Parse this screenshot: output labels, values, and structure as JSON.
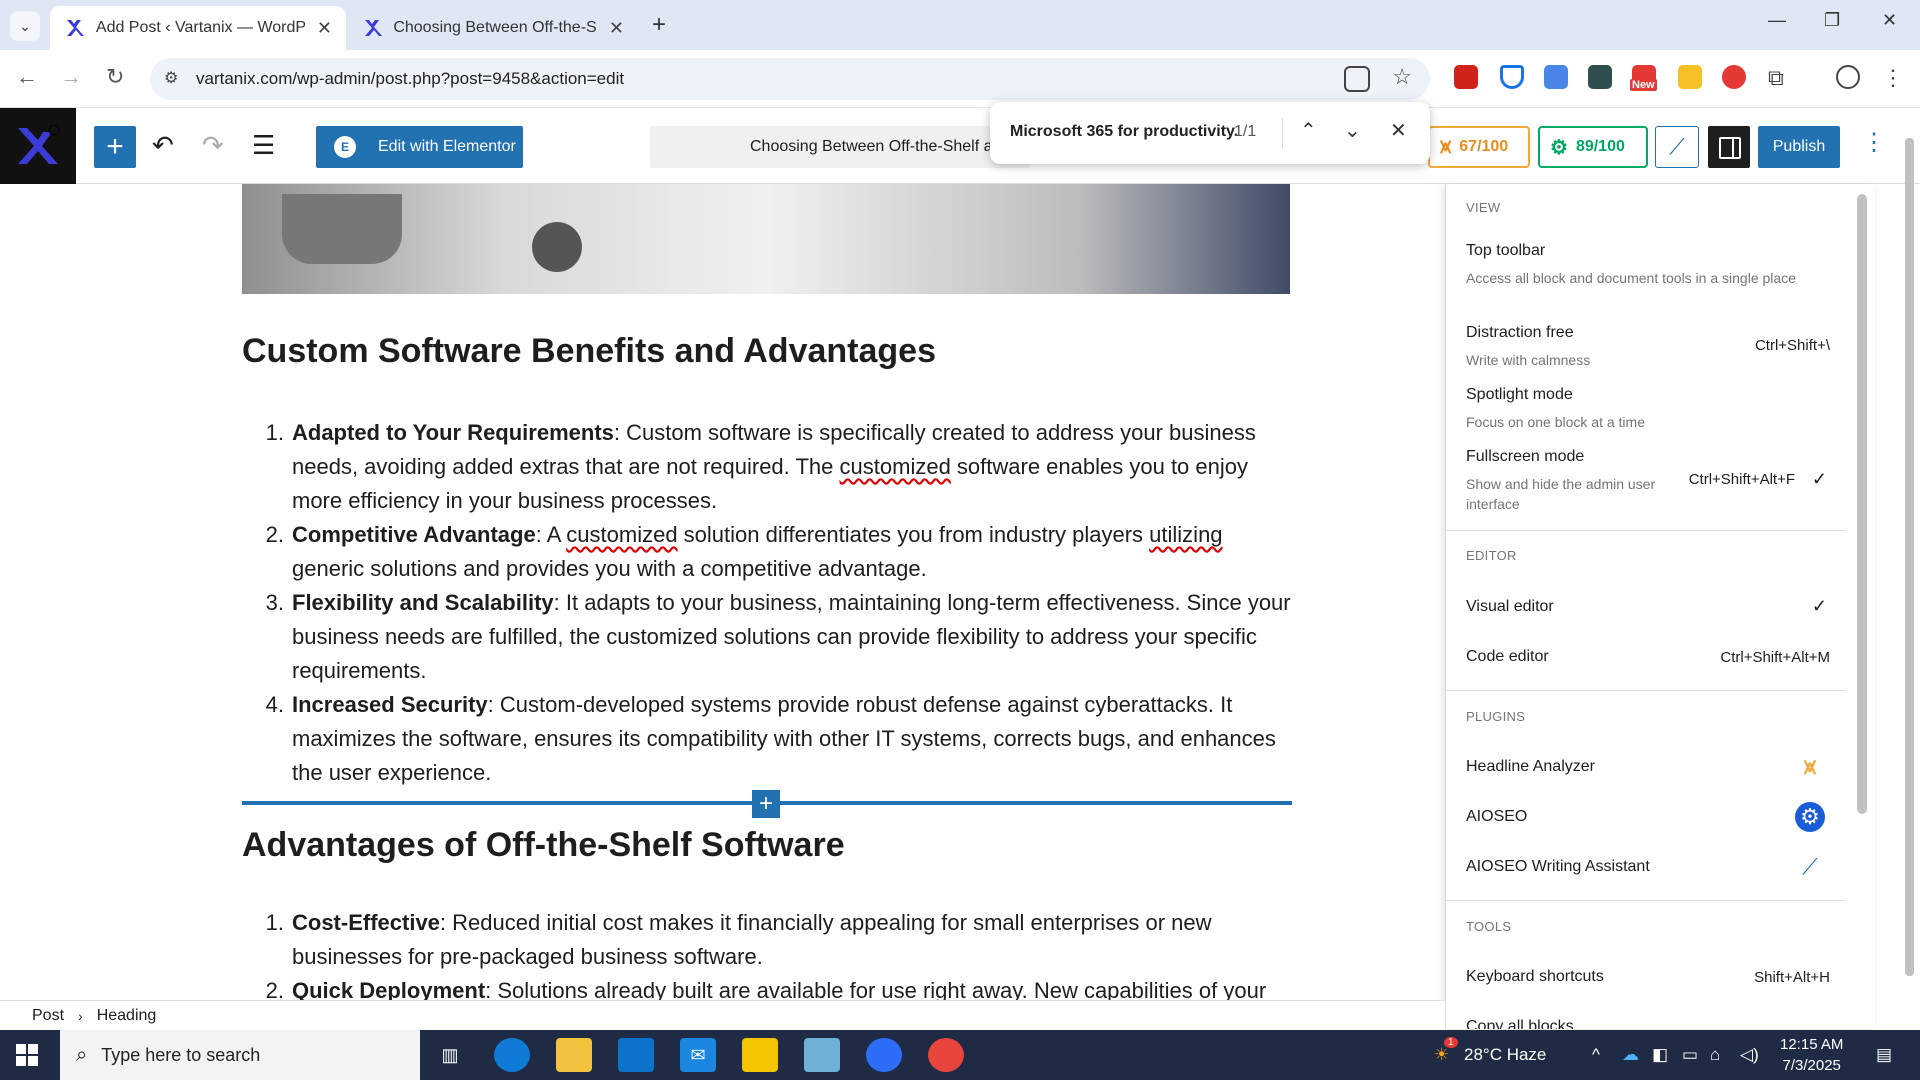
{
  "browser": {
    "tabs": [
      {
        "title": "Add Post ‹ Vartanix — WordPre"
      },
      {
        "title": "Choosing Between Off-the-Shel"
      }
    ],
    "url": "vartanix.com/wp-admin/post.php?post=9458&action=edit"
  },
  "extensions": {
    "new_badge": "New"
  },
  "toolbar": {
    "elementor_label": "Edit with Elementor",
    "doc_title": "Choosing Between Off-the-Shelf a",
    "headline_score": "67/100",
    "seo_score": "89/100",
    "publish_label": "Publish"
  },
  "find": {
    "query": "Microsoft 365 for productivity.",
    "count": "1/1"
  },
  "content": {
    "heading1": "Custom Software Benefits and Advantages",
    "list1": [
      {
        "num": "1.",
        "bold": "Adapted to Your Requirements",
        "pre": ": Custom software is specifically created to address your business needs, avoiding added extras that are not required. The ",
        "sq": "customized",
        "post": " software enables you to enjoy more efficiency in your business processes."
      },
      {
        "num": "2.",
        "bold": "Competitive Advantage",
        "pre": ": A ",
        "sq": "customized",
        "mid": " solution differentiates you from industry players ",
        "sq2": "utilizing",
        "post": " generic solutions and provides you with a competitive advantage."
      },
      {
        "num": "3.",
        "bold": "Flexibility and Scalability",
        "pre": ": It adapts to your business, maintaining long-term effectiveness. Since your business needs are fulfilled, the customized solutions can provide flexibility to address your specific requirements."
      },
      {
        "num": "4.",
        "bold": "Increased Security",
        "pre": ": Custom-developed systems provide robust defense against cyberattacks. It maximizes the software, ensures its compatibility with other IT systems, corrects bugs, and enhances the user experience."
      }
    ],
    "heading2": "Advantages of Off-the-Shelf Software",
    "list2": [
      {
        "num": "1.",
        "bold": "Cost-Effective",
        "pre": ": Reduced initial cost makes it financially appealing for small enterprises or new businesses for pre-packaged business software."
      },
      {
        "num": "2.",
        "bold": "Quick Deployment",
        "pre": ": Solutions already built are available for use right away. New capabilities of your"
      }
    ]
  },
  "menu": {
    "view_title": "VIEW",
    "top_toolbar": {
      "label": "Top toolbar",
      "desc": "Access all block and document tools in a single place"
    },
    "distraction": {
      "label": "Distraction free",
      "desc": "Write with calmness",
      "shortcut": "Ctrl+Shift+\\"
    },
    "spotlight": {
      "label": "Spotlight mode",
      "desc": "Focus on one block at a time"
    },
    "fullscreen": {
      "label": "Fullscreen mode",
      "desc": "Show and hide the admin user interface",
      "shortcut": "Ctrl+Shift+Alt+F"
    },
    "editor_title": "EDITOR",
    "visual": {
      "label": "Visual editor"
    },
    "code": {
      "label": "Code editor",
      "shortcut": "Ctrl+Shift+Alt+M"
    },
    "plugins_title": "PLUGINS",
    "headline": {
      "label": "Headline Analyzer"
    },
    "aioseo": {
      "label": "AIOSEO"
    },
    "writing": {
      "label": "AIOSEO Writing Assistant"
    },
    "tools_title": "TOOLS",
    "shortcuts": {
      "label": "Keyboard shortcuts",
      "shortcut": "Shift+Alt+H"
    },
    "copy_all": {
      "label": "Copy all blocks"
    }
  },
  "breadcrumb": {
    "items": [
      "Post",
      "Heading"
    ]
  },
  "taskbar": {
    "search_placeholder": "Type here to search",
    "weather": "28°C  Haze",
    "weather_badge": "1",
    "time": "12:15 AM",
    "date": "7/3/2025"
  },
  "colors": {
    "wp_blue": "#2271b1",
    "aioseo_green": "#00aa63",
    "headline_orange": "#e78d1d"
  }
}
